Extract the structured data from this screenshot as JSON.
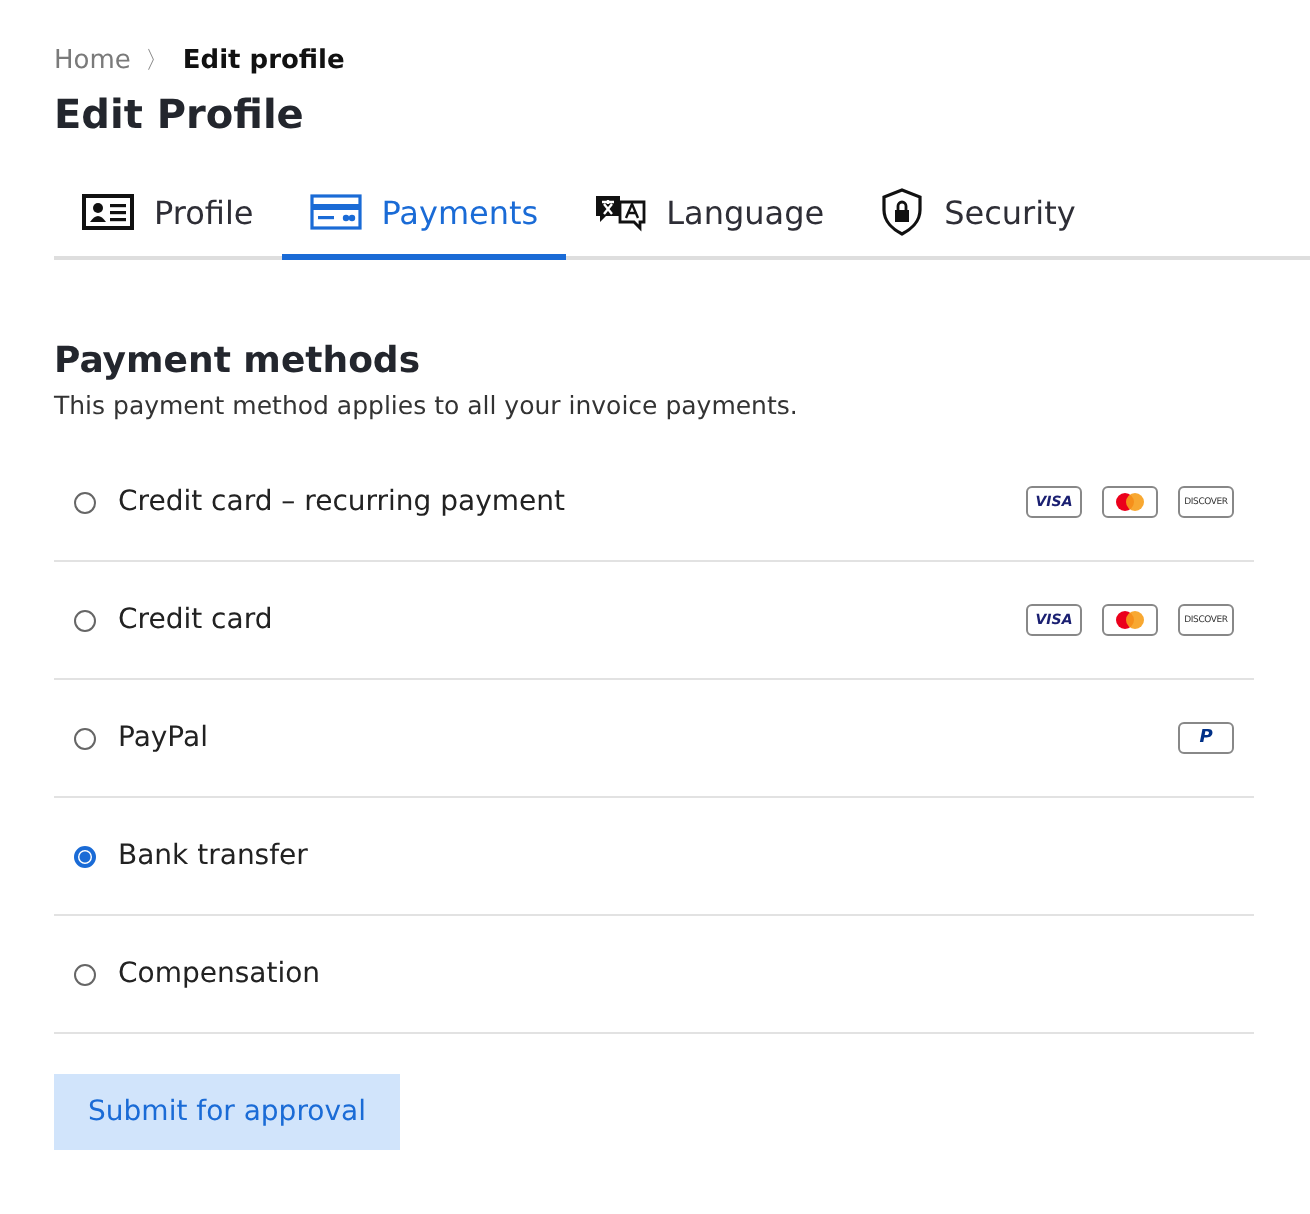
{
  "breadcrumb": [
    {
      "label": "Home",
      "current": false
    },
    {
      "label": "Edit profile",
      "current": true
    }
  ],
  "breadcrumb_separator": "〉",
  "title": "Edit Profile",
  "tabs": [
    {
      "label": "Profile",
      "kind": "profile",
      "selected": false
    },
    {
      "label": "Payments",
      "kind": "payments",
      "selected": true
    },
    {
      "label": "Language",
      "kind": "language",
      "selected": false
    },
    {
      "label": "Security",
      "kind": "security",
      "selected": false
    }
  ],
  "section": {
    "title": "Payment methods",
    "description": "This payment method applies to all your invoice payments."
  },
  "methods": [
    {
      "label": "Credit card – recurring payment",
      "selected": false,
      "cards": [
        {
          "kind": "visa",
          "label": "VISA"
        },
        {
          "kind": "mastercard"
        },
        {
          "kind": "discover",
          "label": "DISCOVER"
        }
      ]
    },
    {
      "label": "Credit card",
      "selected": false,
      "cards": [
        {
          "kind": "visa",
          "label": "VISA"
        },
        {
          "kind": "mastercard"
        },
        {
          "kind": "discover",
          "label": "DISCOVER"
        }
      ]
    },
    {
      "label": "PayPal",
      "selected": false,
      "cards": [
        {
          "kind": "paypal",
          "label": "P"
        }
      ]
    },
    {
      "label": "Bank transfer",
      "selected": true
    },
    {
      "label": "Compensation",
      "selected": false
    }
  ],
  "submit_button": "Submit for approval"
}
